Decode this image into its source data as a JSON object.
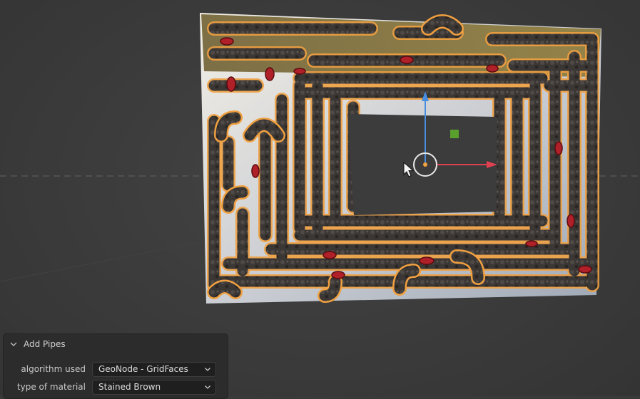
{
  "operator_panel": {
    "title": "Add Pipes",
    "fields": [
      {
        "label": "algorithm used",
        "value": "GeoNode - GridFaces"
      },
      {
        "label": "type of material",
        "value": "Stained Brown"
      }
    ]
  },
  "colors": {
    "viewport_bg": "#3b3b3b",
    "selection_outline": "#f0a040",
    "gizmo_x": "#e04050",
    "gizmo_z": "#4a8ee0",
    "gizmo_plane": "#5aa02c",
    "pipe_metal": "#3a3634",
    "valve_red": "#b02028",
    "panel_bg": "#2c2c2c"
  },
  "icons": {
    "collapse": "chevron-down-icon",
    "dropdown": "chevron-down-icon",
    "origin": "object-origin-icon",
    "cursor": "mouse-cursor-icon"
  }
}
